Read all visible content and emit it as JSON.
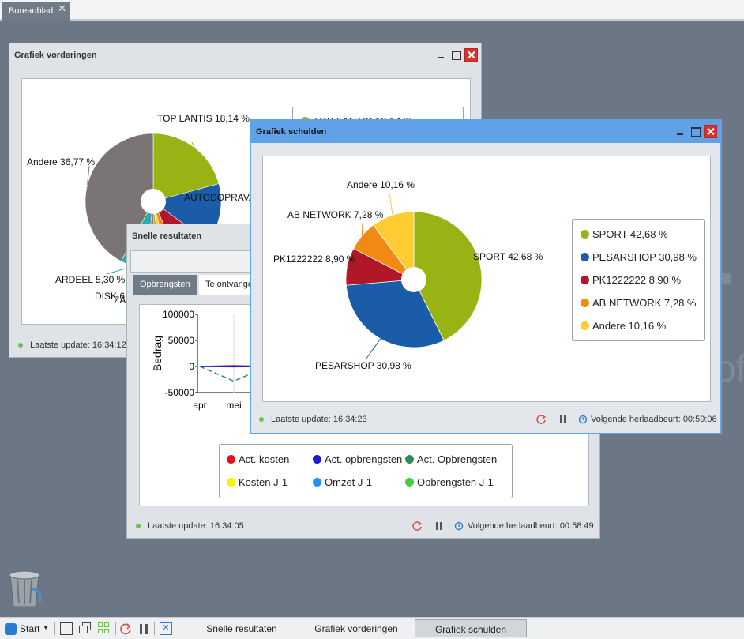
{
  "desktop": {
    "tab_label": "Bureaublad",
    "watermark_letter": "r",
    "watermark_suffix": "oft"
  },
  "colors": {
    "desktop": "#6b7784",
    "active_title": "#5fa2e8",
    "accent_refresh": "#d9534f",
    "status_ok": "#6cbf4e"
  },
  "window_vorderingen": {
    "title": "Grafiek vorderingen",
    "status": "Laatste update: 16:34:12",
    "legend_partial": "TOP LANTIS 18,14 %",
    "chart_data": {
      "type": "pie",
      "slices": [
        {
          "label": "TOP LANTIS 18,14 %",
          "value": 18.14,
          "color": "#98b414"
        },
        {
          "label": "AUTODOPRAVA",
          "value": 12.5,
          "color": "#1a5ca8"
        },
        {
          "label": "",
          "value": 7.0,
          "color": "#b0182a"
        },
        {
          "label": "ZA",
          "value": 2.6,
          "color": "#f08a12"
        },
        {
          "label": "",
          "value": 1.8,
          "color": "#f5cb2a"
        },
        {
          "label": "",
          "value": 1.5,
          "color": "#7fc43a"
        },
        {
          "label": "DISK 6",
          "value": 1.6,
          "color": "#c9208a"
        },
        {
          "label": "ARDEEL 5,30 %",
          "value": 5.3,
          "color": "#27b0a6"
        },
        {
          "label": "Andere 36,77 %",
          "value": 36.77,
          "color": "#7b7474"
        }
      ]
    }
  },
  "window_snelle": {
    "title": "Snelle resultaten",
    "tabs": [
      "Opbrengsten",
      "Te ontvange"
    ],
    "status": "Laatste update: 16:34:05",
    "next_reload": "Volgende herlaadbeurt: 00:58:49",
    "chart_data": {
      "type": "line",
      "ylabel": "Bedrag",
      "yticks": [
        "100000",
        "50000",
        "0",
        "-50000"
      ],
      "ylim": [
        -50000,
        100000
      ],
      "categories": [
        "apr",
        "mei"
      ],
      "series": [
        {
          "name": "Act. kosten",
          "color": "#e0141c",
          "values": [
            0,
            1500,
            0
          ]
        },
        {
          "name": "Act. opbrengsten",
          "color": "#1b1bd6",
          "values": [
            0,
            -500,
            0
          ]
        },
        {
          "name": "Act. Opbrengsten",
          "color": "#2e8b57",
          "values": [
            0,
            -28000,
            0
          ]
        },
        {
          "name": "Kosten J-1",
          "color": "#f5f500",
          "values": []
        },
        {
          "name": "Omzet J-1",
          "color": "#1e90ff",
          "values": []
        },
        {
          "name": "Opbrengsten J-1",
          "color": "#3fcf3f",
          "values": []
        }
      ]
    }
  },
  "window_schulden": {
    "title": "Grafiek schulden",
    "status": "Laatste update: 16:34:23",
    "next_reload": "Volgende herlaadbeurt: 00:59:06",
    "chart_data": {
      "type": "pie",
      "slices": [
        {
          "label": "SPORT 42,68 %",
          "value": 42.68,
          "color": "#98b414"
        },
        {
          "label": "PESARSHOP 30,98 %",
          "value": 30.98,
          "color": "#1a5ca8"
        },
        {
          "label": "PK1222222 8,90 %",
          "value": 8.9,
          "color": "#b0182a"
        },
        {
          "label": "AB NETWORK 7,28 %",
          "value": 7.28,
          "color": "#f08a12"
        },
        {
          "label": "Andere 10,16 %",
          "value": 10.16,
          "color": "#ffcc33"
        }
      ]
    }
  },
  "taskbar": {
    "start": "Start",
    "items": [
      "Snelle resultaten",
      "Grafiek vorderingen",
      "Grafiek schulden"
    ],
    "active": "Grafiek schulden"
  }
}
